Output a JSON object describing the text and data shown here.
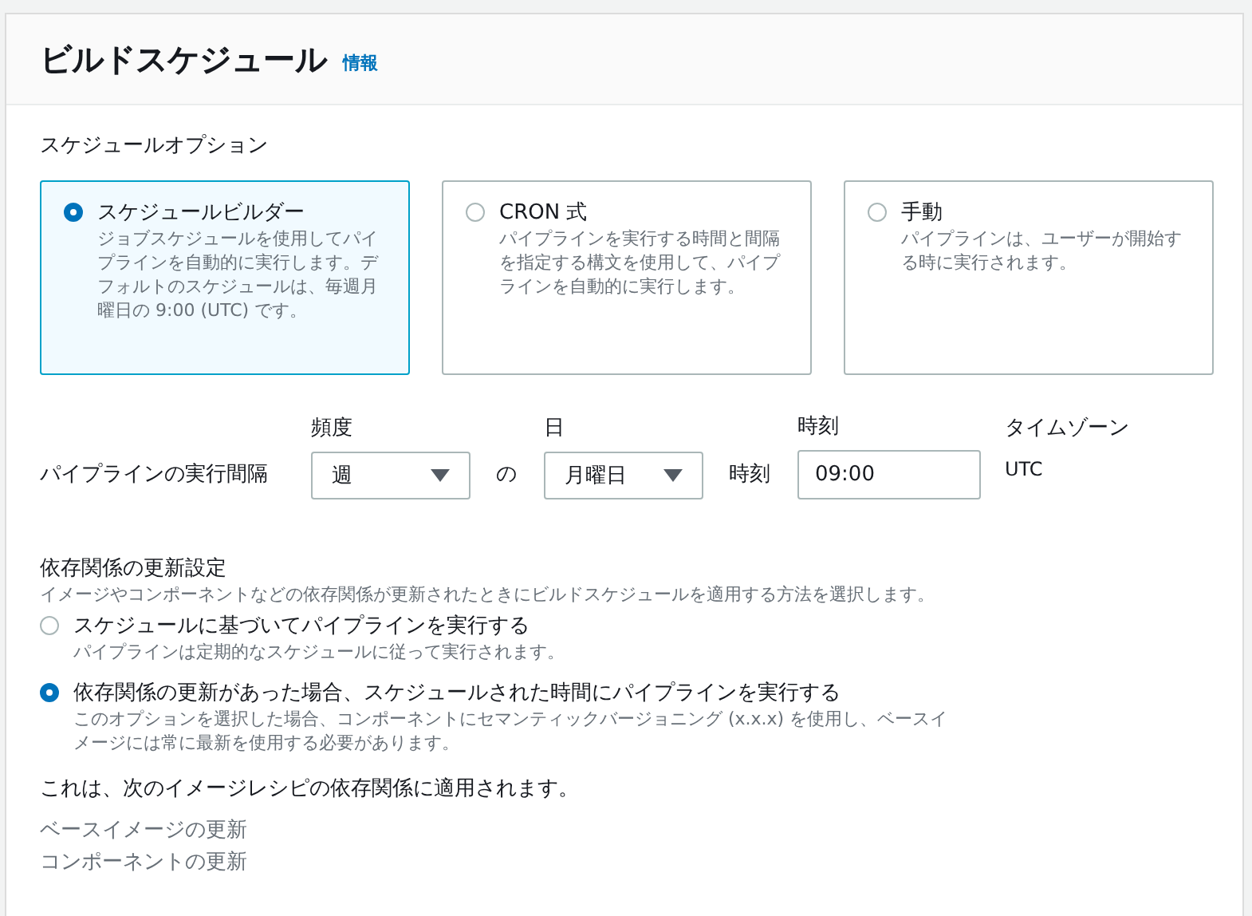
{
  "panel": {
    "title": "ビルドスケジュール",
    "info_link": "情報"
  },
  "schedule_options": {
    "label": "スケジュールオプション",
    "options": [
      {
        "title": "スケジュールビルダー",
        "description": "ジョブスケジュールを使用してパイプラインを自動的に実行します。デフォルトのスケジュールは、毎週月曜日の 9:00 (UTC) です。",
        "selected": true
      },
      {
        "title": "CRON 式",
        "description": "パイプラインを実行する時間と間隔を指定する構文を使用して、パイプラインを自動的に実行します。",
        "selected": false
      },
      {
        "title": "手動",
        "description": "パイプラインは、ユーザーが開始する時に実行されます。",
        "selected": false
      }
    ]
  },
  "interval": {
    "label": "パイプラインの実行間隔",
    "frequency": {
      "label": "頻度",
      "value": "週"
    },
    "of_text": "の",
    "day": {
      "label": "日",
      "value": "月曜日"
    },
    "time_inline_label": "時刻",
    "time": {
      "label": "時刻",
      "value": "09:00"
    },
    "timezone": {
      "label": "タイムゾーン",
      "value": "UTC"
    }
  },
  "dependency_update": {
    "label": "依存関係の更新設定",
    "description": "イメージやコンポーネントなどの依存関係が更新されたときにビルドスケジュールを適用する方法を選択します。",
    "options": [
      {
        "title": "スケジュールに基づいてパイプラインを実行する",
        "description": "パイプラインは定期的なスケジュールに従って実行されます。",
        "selected": false
      },
      {
        "title": "依存関係の更新があった場合、スケジュールされた時間にパイプラインを実行する",
        "description": "このオプションを選択した場合、コンポーネントにセマンティックバージョニング (x.x.x) を使用し、ベースイメージには常に最新を使用する必要があります。",
        "selected": true
      }
    ]
  },
  "applies_to": {
    "text": "これは、次のイメージレシピの依存関係に適用されます。",
    "items": [
      "ベースイメージの更新",
      "コンポーネントの更新"
    ]
  }
}
